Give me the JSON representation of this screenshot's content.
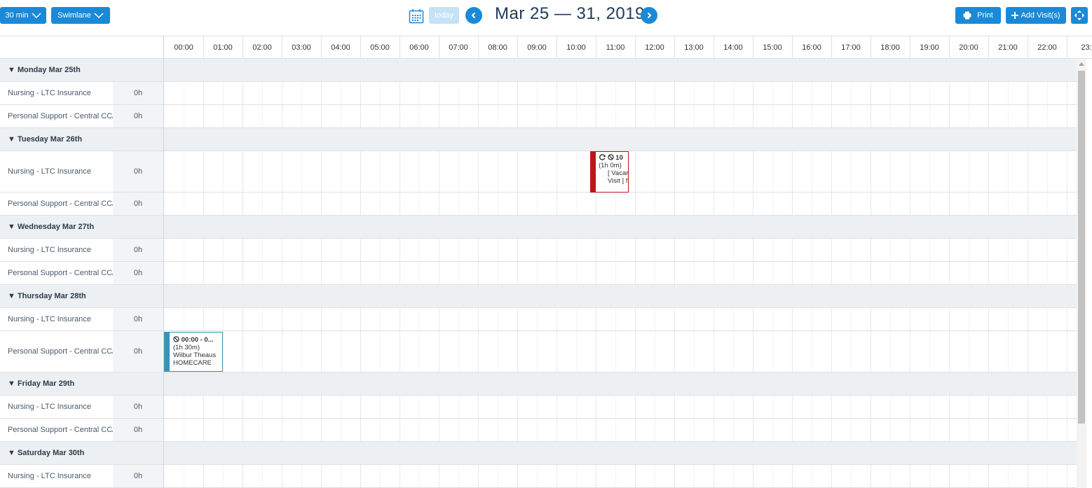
{
  "toolbar": {
    "interval_label": "30 min",
    "view_label": "Swimlane",
    "today_label": "today",
    "date_range": "Mar 25 — 31, 2019",
    "print_label": "Print",
    "add_visit_label": "Add Visit(s)"
  },
  "hours": [
    "00:00",
    "01:00",
    "02:00",
    "03:00",
    "04:00",
    "05:00",
    "06:00",
    "07:00",
    "08:00",
    "09:00",
    "10:00",
    "11:00",
    "12:00",
    "13:00",
    "14:00",
    "15:00",
    "16:00",
    "17:00",
    "18:00",
    "19:00",
    "20:00",
    "21:00",
    "22:00",
    "23:"
  ],
  "rows": [
    {
      "type": "day",
      "label": "▼ Monday Mar 25th"
    },
    {
      "type": "res",
      "label": "Nursing - LTC Insurance",
      "hours": "0h"
    },
    {
      "type": "res",
      "label": "Personal Support - Central CC/",
      "hours": "0h"
    },
    {
      "type": "day",
      "label": "▼ Tuesday Mar 26th"
    },
    {
      "type": "res",
      "label": "Nursing - LTC Insurance",
      "hours": "0h",
      "tall": true
    },
    {
      "type": "res",
      "label": "Personal Support - Central CC/",
      "hours": "0h"
    },
    {
      "type": "day",
      "label": "▼ Wednesday Mar 27th"
    },
    {
      "type": "res",
      "label": "Nursing - LTC Insurance",
      "hours": "0h"
    },
    {
      "type": "res",
      "label": "Personal Support - Central CC/",
      "hours": "0h"
    },
    {
      "type": "day",
      "label": "▼ Thursday Mar 28th"
    },
    {
      "type": "res",
      "label": "Nursing - LTC Insurance",
      "hours": "0h"
    },
    {
      "type": "res",
      "label": "Personal Support - Central CC/",
      "hours": "0h",
      "tall": true
    },
    {
      "type": "day",
      "label": "▼ Friday Mar 29th"
    },
    {
      "type": "res",
      "label": "Nursing - LTC Insurance",
      "hours": "0h"
    },
    {
      "type": "res",
      "label": "Personal Support - Central CC/",
      "hours": "0h"
    },
    {
      "type": "day",
      "label": "▼ Saturday Mar 30th"
    },
    {
      "type": "res",
      "label": "Nursing - LTC Insurance",
      "hours": "0h"
    }
  ],
  "events": {
    "tuesday": {
      "time": "10",
      "duration": "(1h 0m)",
      "line1": "[ Vacar",
      "line2": "Visit ] f",
      "color": "#c0141c"
    },
    "thursday": {
      "time": "00:00 - 0...",
      "duration": "(1h 30m)",
      "line1": "Wilbur Theaus",
      "line2": "HOMECARE",
      "color": "#3a93b5"
    }
  }
}
